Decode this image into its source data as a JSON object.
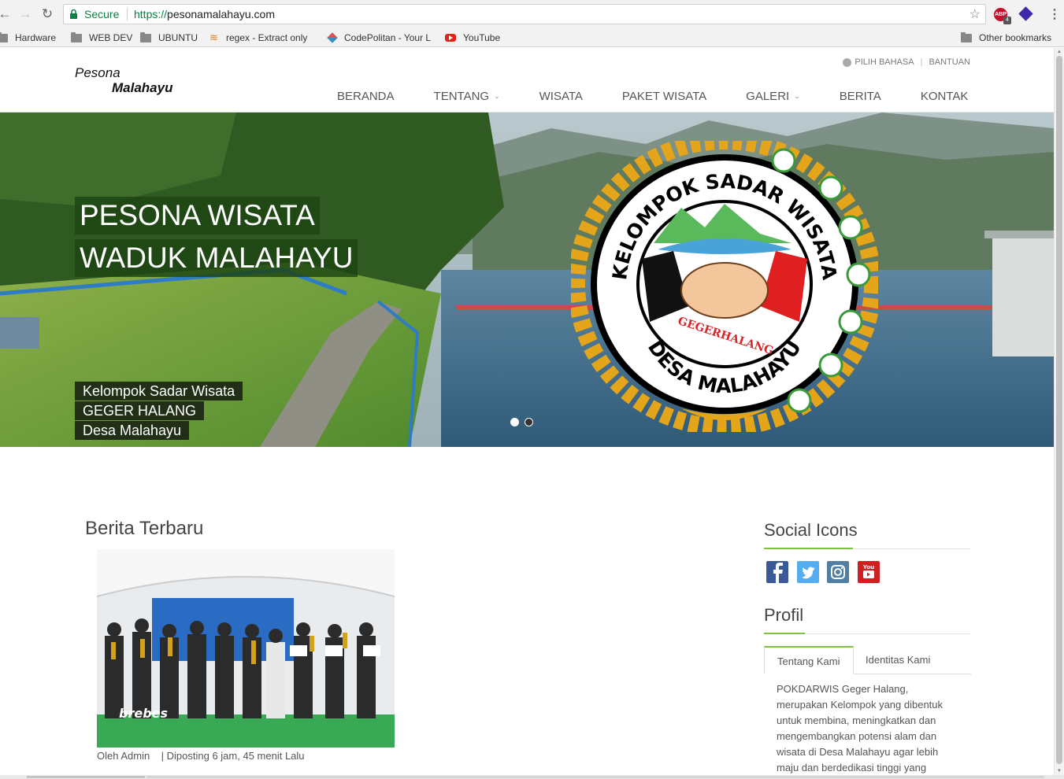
{
  "browser": {
    "secure_label": "Secure",
    "url_scheme": "https://",
    "url_host": "pesonamalahayu.com",
    "abp_label": "ABP",
    "abp_count": "4",
    "bookmarks": [
      "Hardware",
      "WEB DEV",
      "UBUNTU",
      "regex - Extract only",
      "CodePolitan - Your L",
      "YouTube"
    ],
    "other_bookmarks": "Other bookmarks"
  },
  "header": {
    "logo_line1": "Pesona",
    "logo_line2": "Malahayu",
    "lang": "PILIH BAHASA",
    "help": "BANTUAN",
    "nav": [
      "BERANDA",
      "TENTANG",
      "WISATA",
      "PAKET WISATA",
      "GALERI",
      "BERITA",
      "KONTAK"
    ]
  },
  "hero": {
    "title1": "PESONA WISATA",
    "title2": "WADUK MALAHAYU",
    "sub1": "Kelompok Sadar Wisata",
    "sub2": "GEGER HALANG",
    "sub3": "Desa Malahayu",
    "emblem_top": "KELOMPOK SADAR WISATA",
    "emblem_mid": "GEGERHALANG",
    "emblem_bottom": "DESA MALAHAYU",
    "slide_count": 2,
    "active_slide": 1
  },
  "news": {
    "title": "Berita Terbaru",
    "photo_caption": "brebes",
    "author": "Oleh Admin",
    "posted": "| Diposting 6 jam, 45 menit Lalu"
  },
  "sidebar": {
    "social_title": "Social Icons",
    "social": [
      "facebook-icon",
      "twitter-icon",
      "instagram-icon",
      "youtube-icon"
    ],
    "social_colors": [
      "#3b5998",
      "#55acee",
      "#517fa4",
      "#cd201f"
    ],
    "profil_title": "Profil",
    "tabs": [
      "Tentang Kami",
      "Identitas Kami"
    ],
    "profil_text": "POKDARWIS Geger Halang, merupakan Kelompok yang dibentuk untuk membina, meningkatkan dan mengembangkan potensi alam dan wisata di Desa Malahayu agar lebih maju dan berdedikasi tinggi yang"
  },
  "colors": {
    "accent": "#7dc243",
    "secure": "#0b8043"
  }
}
